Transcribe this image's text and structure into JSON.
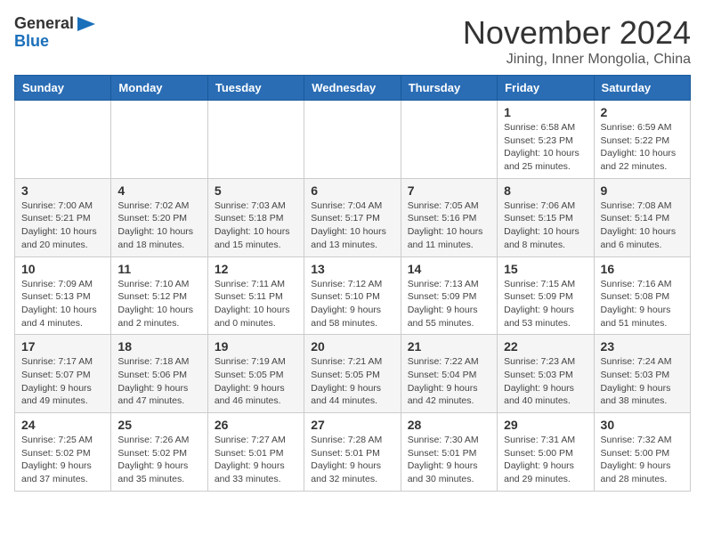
{
  "header": {
    "logo_general": "General",
    "logo_blue": "Blue",
    "month_title": "November 2024",
    "location": "Jining, Inner Mongolia, China"
  },
  "days_of_week": [
    "Sunday",
    "Monday",
    "Tuesday",
    "Wednesday",
    "Thursday",
    "Friday",
    "Saturday"
  ],
  "weeks": [
    [
      {
        "day": "",
        "info": ""
      },
      {
        "day": "",
        "info": ""
      },
      {
        "day": "",
        "info": ""
      },
      {
        "day": "",
        "info": ""
      },
      {
        "day": "",
        "info": ""
      },
      {
        "day": "1",
        "info": "Sunrise: 6:58 AM\nSunset: 5:23 PM\nDaylight: 10 hours and 25 minutes."
      },
      {
        "day": "2",
        "info": "Sunrise: 6:59 AM\nSunset: 5:22 PM\nDaylight: 10 hours and 22 minutes."
      }
    ],
    [
      {
        "day": "3",
        "info": "Sunrise: 7:00 AM\nSunset: 5:21 PM\nDaylight: 10 hours and 20 minutes."
      },
      {
        "day": "4",
        "info": "Sunrise: 7:02 AM\nSunset: 5:20 PM\nDaylight: 10 hours and 18 minutes."
      },
      {
        "day": "5",
        "info": "Sunrise: 7:03 AM\nSunset: 5:18 PM\nDaylight: 10 hours and 15 minutes."
      },
      {
        "day": "6",
        "info": "Sunrise: 7:04 AM\nSunset: 5:17 PM\nDaylight: 10 hours and 13 minutes."
      },
      {
        "day": "7",
        "info": "Sunrise: 7:05 AM\nSunset: 5:16 PM\nDaylight: 10 hours and 11 minutes."
      },
      {
        "day": "8",
        "info": "Sunrise: 7:06 AM\nSunset: 5:15 PM\nDaylight: 10 hours and 8 minutes."
      },
      {
        "day": "9",
        "info": "Sunrise: 7:08 AM\nSunset: 5:14 PM\nDaylight: 10 hours and 6 minutes."
      }
    ],
    [
      {
        "day": "10",
        "info": "Sunrise: 7:09 AM\nSunset: 5:13 PM\nDaylight: 10 hours and 4 minutes."
      },
      {
        "day": "11",
        "info": "Sunrise: 7:10 AM\nSunset: 5:12 PM\nDaylight: 10 hours and 2 minutes."
      },
      {
        "day": "12",
        "info": "Sunrise: 7:11 AM\nSunset: 5:11 PM\nDaylight: 10 hours and 0 minutes."
      },
      {
        "day": "13",
        "info": "Sunrise: 7:12 AM\nSunset: 5:10 PM\nDaylight: 9 hours and 58 minutes."
      },
      {
        "day": "14",
        "info": "Sunrise: 7:13 AM\nSunset: 5:09 PM\nDaylight: 9 hours and 55 minutes."
      },
      {
        "day": "15",
        "info": "Sunrise: 7:15 AM\nSunset: 5:09 PM\nDaylight: 9 hours and 53 minutes."
      },
      {
        "day": "16",
        "info": "Sunrise: 7:16 AM\nSunset: 5:08 PM\nDaylight: 9 hours and 51 minutes."
      }
    ],
    [
      {
        "day": "17",
        "info": "Sunrise: 7:17 AM\nSunset: 5:07 PM\nDaylight: 9 hours and 49 minutes."
      },
      {
        "day": "18",
        "info": "Sunrise: 7:18 AM\nSunset: 5:06 PM\nDaylight: 9 hours and 47 minutes."
      },
      {
        "day": "19",
        "info": "Sunrise: 7:19 AM\nSunset: 5:05 PM\nDaylight: 9 hours and 46 minutes."
      },
      {
        "day": "20",
        "info": "Sunrise: 7:21 AM\nSunset: 5:05 PM\nDaylight: 9 hours and 44 minutes."
      },
      {
        "day": "21",
        "info": "Sunrise: 7:22 AM\nSunset: 5:04 PM\nDaylight: 9 hours and 42 minutes."
      },
      {
        "day": "22",
        "info": "Sunrise: 7:23 AM\nSunset: 5:03 PM\nDaylight: 9 hours and 40 minutes."
      },
      {
        "day": "23",
        "info": "Sunrise: 7:24 AM\nSunset: 5:03 PM\nDaylight: 9 hours and 38 minutes."
      }
    ],
    [
      {
        "day": "24",
        "info": "Sunrise: 7:25 AM\nSunset: 5:02 PM\nDaylight: 9 hours and 37 minutes."
      },
      {
        "day": "25",
        "info": "Sunrise: 7:26 AM\nSunset: 5:02 PM\nDaylight: 9 hours and 35 minutes."
      },
      {
        "day": "26",
        "info": "Sunrise: 7:27 AM\nSunset: 5:01 PM\nDaylight: 9 hours and 33 minutes."
      },
      {
        "day": "27",
        "info": "Sunrise: 7:28 AM\nSunset: 5:01 PM\nDaylight: 9 hours and 32 minutes."
      },
      {
        "day": "28",
        "info": "Sunrise: 7:30 AM\nSunset: 5:01 PM\nDaylight: 9 hours and 30 minutes."
      },
      {
        "day": "29",
        "info": "Sunrise: 7:31 AM\nSunset: 5:00 PM\nDaylight: 9 hours and 29 minutes."
      },
      {
        "day": "30",
        "info": "Sunrise: 7:32 AM\nSunset: 5:00 PM\nDaylight: 9 hours and 28 minutes."
      }
    ]
  ]
}
